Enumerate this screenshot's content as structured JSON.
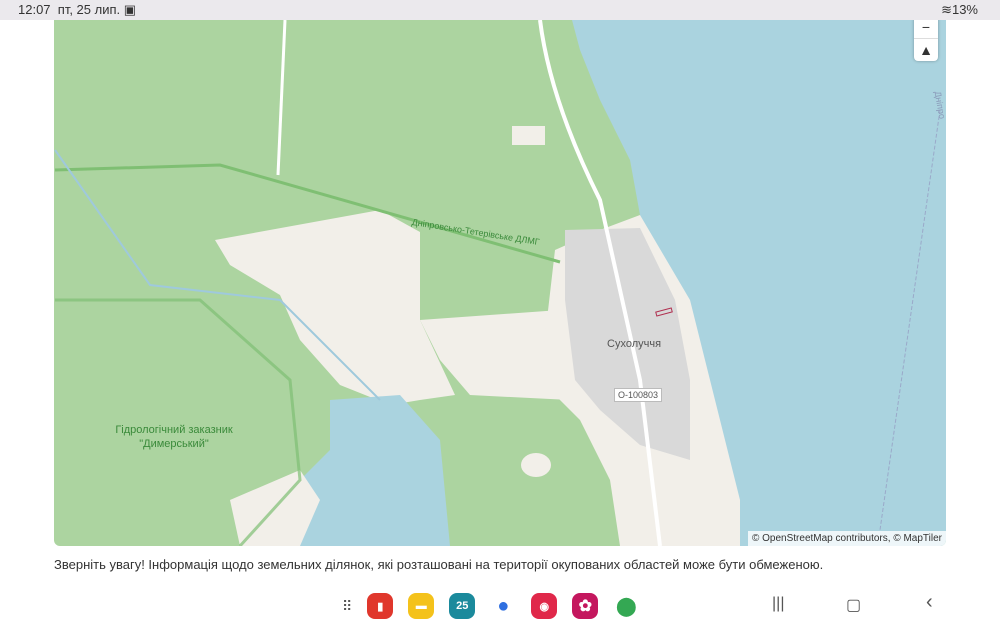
{
  "status_bar": {
    "time": "12:07",
    "date": "пт, 25 лип.",
    "battery": "13%"
  },
  "map": {
    "zoom_out": "−",
    "compass": "▲",
    "labels": {
      "pipeline": "Дніпровсько-Тетерівське ДЛМГ",
      "village": "Сухолуччя",
      "road_ref": "О-100803",
      "reserve": "Гідрологічний заказник \"Димерський\"",
      "river": "Дніпро"
    },
    "attribution": "© OpenStreetMap contributors, © MapTiler",
    "colors": {
      "forest": "#acd4a0",
      "water": "#aad3df",
      "land": "#f2efe9",
      "residential": "#d9d9d9"
    }
  },
  "notice": "Зверніть увагу! Інформація щодо земельних ділянок, які розташовані на території окупованих областей може бути обмеженою.",
  "taskbar": {
    "apps": [
      {
        "name": "notes",
        "color": "#e0372c"
      },
      {
        "name": "files",
        "color": "#f4c21b"
      },
      {
        "name": "calendar",
        "color": "#1b8a9c",
        "text": "25"
      },
      {
        "name": "messages",
        "color": "#fff"
      },
      {
        "name": "screen-recorder",
        "color": "#e0284a"
      },
      {
        "name": "gallery",
        "color": "#c4175e"
      },
      {
        "name": "maps",
        "color": "#fff"
      }
    ],
    "recents": "|||",
    "home": "▢",
    "back": "‹"
  }
}
